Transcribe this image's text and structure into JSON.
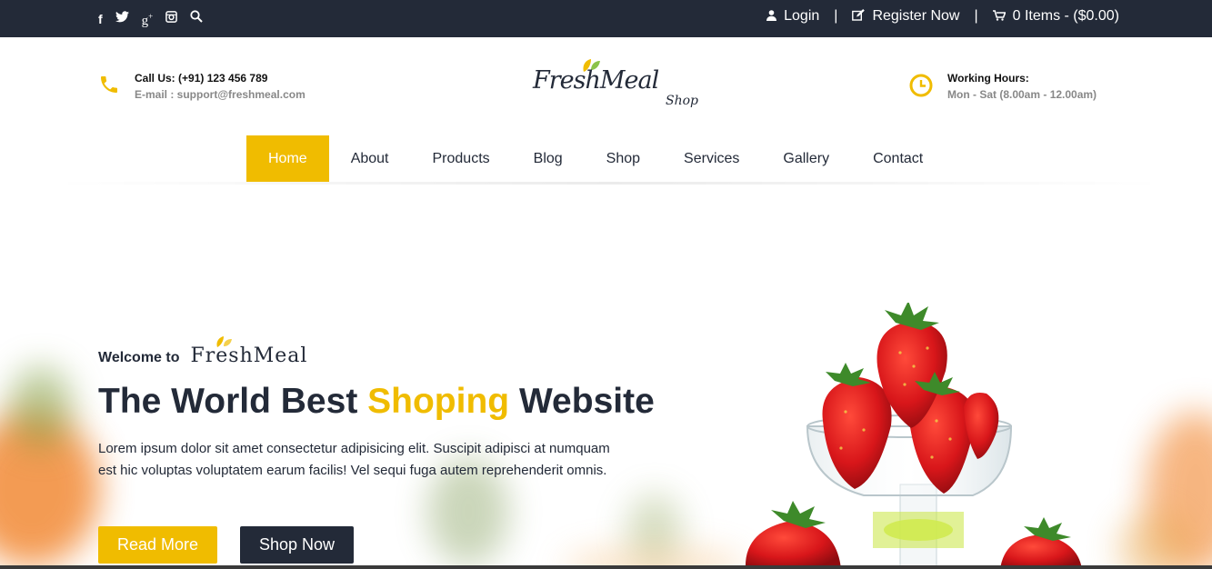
{
  "topbar": {
    "social_icons": [
      "facebook-icon",
      "twitter-icon",
      "google-plus-icon",
      "instagram-icon",
      "search-icon"
    ],
    "social_glyphs": [
      "f",
      "t",
      "g+",
      "◎",
      "⌕"
    ],
    "login": "Login",
    "register": "Register Now",
    "cart": "0 Items - ($0.00)",
    "separator": "|"
  },
  "header": {
    "call_label": "Call Us: (+91) 123 456 789",
    "email_label": "E-mail : support@freshmeal.com",
    "logo_brand": "FreshMeal",
    "logo_sub": "Shop",
    "hours_title": "Working Hours:",
    "hours_value": "Mon - Sat (8.00am - 12.00am)"
  },
  "nav": {
    "items": [
      "Home",
      "About",
      "Products",
      "Blog",
      "Shop",
      "Services",
      "Gallery",
      "Contact"
    ],
    "active": "Home"
  },
  "hero": {
    "welcome": "Welcome to",
    "welcome_brand": "FreshMeal",
    "headline_part1": "The World Best ",
    "headline_highlight": "Shoping",
    "headline_part2": " Website",
    "description": "Lorem ipsum dolor sit amet consectetur adipisicing elit. Suscipit adipisci at numquam est hic voluptas voluptatem earum facilis! Vel sequi fuga autem reprehenderit omnis.",
    "read_more": "Read More",
    "shop_now": "Shop Now"
  },
  "colors": {
    "accent": "#f0bc00",
    "dark": "#232a38"
  }
}
